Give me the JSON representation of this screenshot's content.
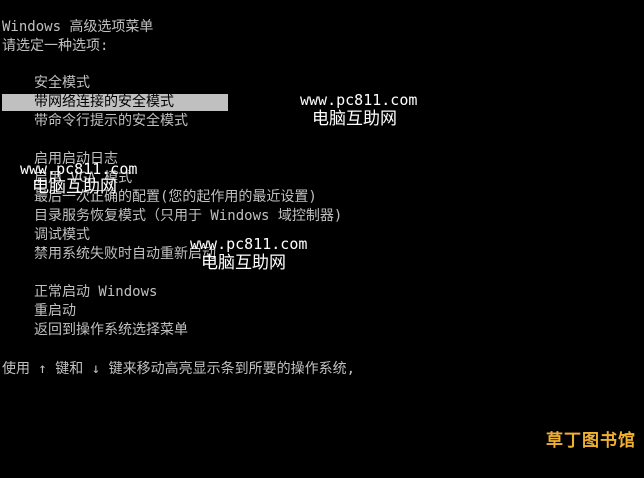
{
  "header": {
    "title": "Windows 高级选项菜单",
    "prompt": "请选定一种选项:"
  },
  "menu": {
    "selected_index": 1,
    "items": [
      {
        "label": "安全模式"
      },
      {
        "label": "带网络连接的安全模式"
      },
      {
        "label": "带命令行提示的安全模式"
      },
      {
        "label": "启用启动日志"
      },
      {
        "label": "启用 VGA 模式"
      },
      {
        "label": "最后一次正确的配置(您的起作用的最近设置)"
      },
      {
        "label": "目录服务恢复模式（只用于 Windows 域控制器)"
      },
      {
        "label": "调试模式"
      },
      {
        "label": "禁用系统失败时自动重新启动"
      },
      {
        "label": "正常启动 Windows"
      },
      {
        "label": "重启动"
      },
      {
        "label": "返回到操作系统选择菜单"
      }
    ]
  },
  "footer": {
    "instructions": "使用 ↑ 键和 ↓ 键来移动高亮显示条到所要的操作系统,"
  },
  "watermarks": [
    {
      "url": "www.pc811.com",
      "cn": "电脑互助网"
    },
    {
      "url": "www.pc811.com",
      "cn": "电脑互助网"
    },
    {
      "url": "www.pc811.com",
      "cn": "电脑互助网"
    }
  ],
  "logo": {
    "text": "草丁图书馆",
    "color": "#f0b030"
  },
  "colors": {
    "background": "#000000",
    "text": "#c0c0c0",
    "highlight": "#c0c0c0"
  }
}
